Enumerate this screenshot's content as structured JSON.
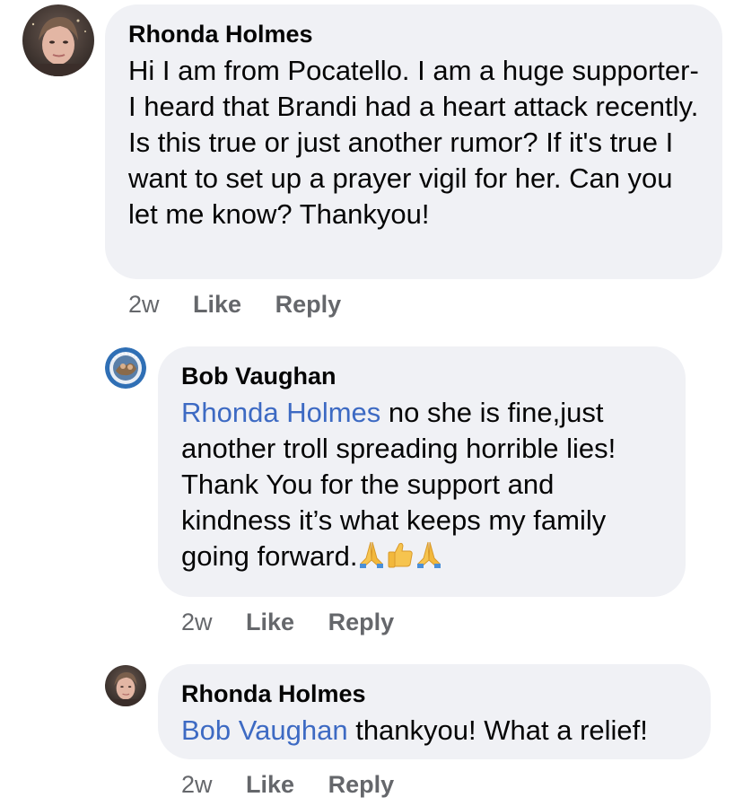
{
  "comments": [
    {
      "author": "Rhonda Holmes",
      "text": "Hi I am from Pocatello.  I am a huge supporter- I heard that Brandi had a heart attack recently.  Is this true or just another rumor? If it's true I want to set up a prayer vigil for her.  Can you let me know?  Thankyou!",
      "time": "2w",
      "like_label": "Like",
      "reply_label": "Reply"
    },
    {
      "author": "Bob Vaughan",
      "mention": "Rhonda Holmes",
      "text": " no she is fine,just another troll spreading horrible lies! Thank You for the support and kindness it’s what keeps my family going forward.",
      "emojis": [
        "folded-hands",
        "thumbs-up",
        "folded-hands"
      ],
      "time": "2w",
      "like_label": "Like",
      "reply_label": "Reply"
    },
    {
      "author": "Rhonda Holmes",
      "mention": "Bob Vaughan",
      "text": " thankyou! What a relief!",
      "time": "2w",
      "like_label": "Like",
      "reply_label": "Reply"
    }
  ],
  "colors": {
    "bubble": "#f0f1f5",
    "mention": "#3d6ac3",
    "meta": "#65676b",
    "text": "#050505"
  }
}
